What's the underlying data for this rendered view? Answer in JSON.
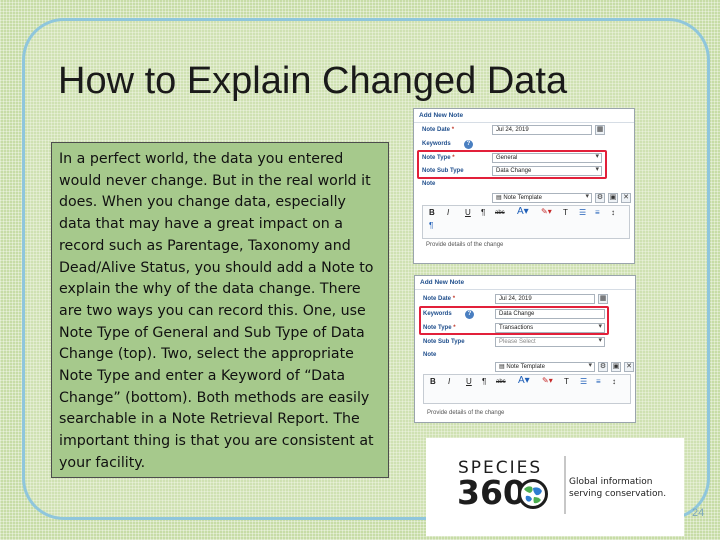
{
  "slide": {
    "title": "How to Explain Changed Data",
    "body": "In a perfect world, the data you entered would never change. But in the real world it does. When you change data, especially data that may have a great impact on a record such as Parentage, Taxonomy and Dead/Alive Status, you should add a Note to explain the why of the data change. There are two ways you can record this. One, use Note Type of General and Sub Type of Data Change (top). Two, select the appropriate Note Type and enter a Keyword of “Data Change” (bottom). Both methods are easily searchable in a Note Retrieval Report. The important thing is that you are consistent at your facility.",
    "page_number": "24"
  },
  "screenshot_top": {
    "header": "Add New Note",
    "note_date_label": "Note Date",
    "note_date_value": "Jul 24, 2019",
    "keywords_label": "Keywords",
    "note_type_label": "Note Type",
    "note_type_value": "General",
    "note_sub_type_label": "Note Sub Type",
    "note_sub_type_value": "Data Change",
    "note_label": "Note",
    "template_placeholder": "Note Template",
    "editor_placeholder": "Provide details of the change"
  },
  "screenshot_bottom": {
    "header": "Add New Note",
    "note_date_label": "Note Date",
    "note_date_value": "Jul 24, 2019",
    "keywords_label": "Keywords",
    "keywords_value": "Data Change",
    "note_type_label": "Note Type",
    "note_type_value": "Transactions",
    "note_sub_type_label": "Note Sub Type",
    "note_sub_type_value": "Please Select",
    "note_label": "Note",
    "template_placeholder": "Note Template",
    "editor_placeholder": "Provide details of the change"
  },
  "logo": {
    "word_top": "SPECIES",
    "word_bottom": "360",
    "tagline_line1": "Global information",
    "tagline_line2": "serving conservation."
  },
  "colors": {
    "background": "#c7dca6",
    "frame_border": "#8fc6dc",
    "textbox_fill": "#a6c98c",
    "highlight": "#e2203a",
    "label_blue": "#1f4e8c"
  },
  "icons": [
    "calendar-icon",
    "info-icon",
    "chevron-down-icon",
    "bold-icon",
    "italic-icon",
    "underline-icon",
    "strikethrough-icon",
    "font-color-icon",
    "highlight-icon",
    "list-icon",
    "globe-icon"
  ]
}
